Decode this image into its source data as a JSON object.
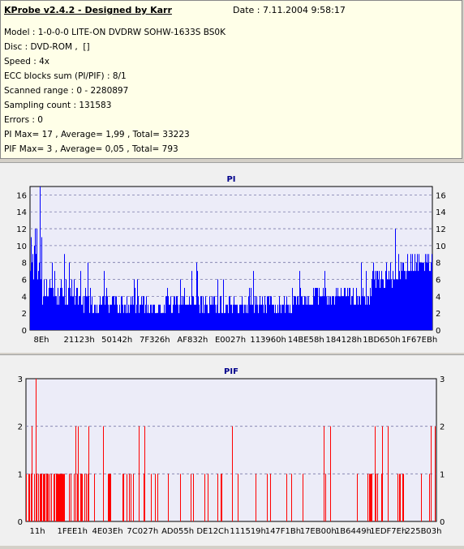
{
  "info": {
    "title": "KProbe v2.4.2 - Designed by Karr",
    "date": "Date : 7.11.2004 9:58:17",
    "lines": [
      "Model : 1-0-0-0 LITE-ON DVDRW SOHW-1633S BS0K",
      "Disc : DVD-ROM ,  []",
      "Speed : 4x",
      "ECC blocks sum (PI/PIF) : 8/1",
      "Scanned range : 0 - 2280897",
      "Sampling count : 131583",
      "Errors : 0",
      "PI Max= 17 , Average= 1,99 , Total= 33223",
      "PIF Max= 3 , Average= 0,05 , Total= 793"
    ]
  },
  "colors": {
    "pi": "#0000ff",
    "pif": "#ff0000",
    "plot_bg": "#ececf8",
    "grid": "#7878a8"
  },
  "chart_data": [
    {
      "type": "bar",
      "title": "PI",
      "ylim": [
        0,
        17
      ],
      "yticks": [
        0,
        2,
        4,
        6,
        8,
        10,
        12,
        14,
        16
      ],
      "xtick_labels": [
        "8Eh",
        "21123h",
        "50142h",
        "7F326h",
        "AF832h",
        "E0027h",
        "113960h",
        "14BE58h",
        "184128h",
        "1BD650h",
        "1F67EBh"
      ],
      "series_profile": {
        "max": 17,
        "average": 1.99
      },
      "grid": true
    },
    {
      "type": "bar",
      "title": "PIF",
      "ylim": [
        0,
        3
      ],
      "yticks": [
        0,
        1,
        2,
        3
      ],
      "xtick_labels": [
        "11h",
        "1FEE1h",
        "4E03Eh",
        "7C027h",
        "AD055h",
        "DE12Ch",
        "111519h",
        "147F1Bh",
        "17EB00h",
        "1B6449h",
        "1EDF7Eh",
        "225B03h"
      ],
      "series_profile": {
        "max": 3,
        "average": 0.05
      },
      "grid": true
    }
  ]
}
